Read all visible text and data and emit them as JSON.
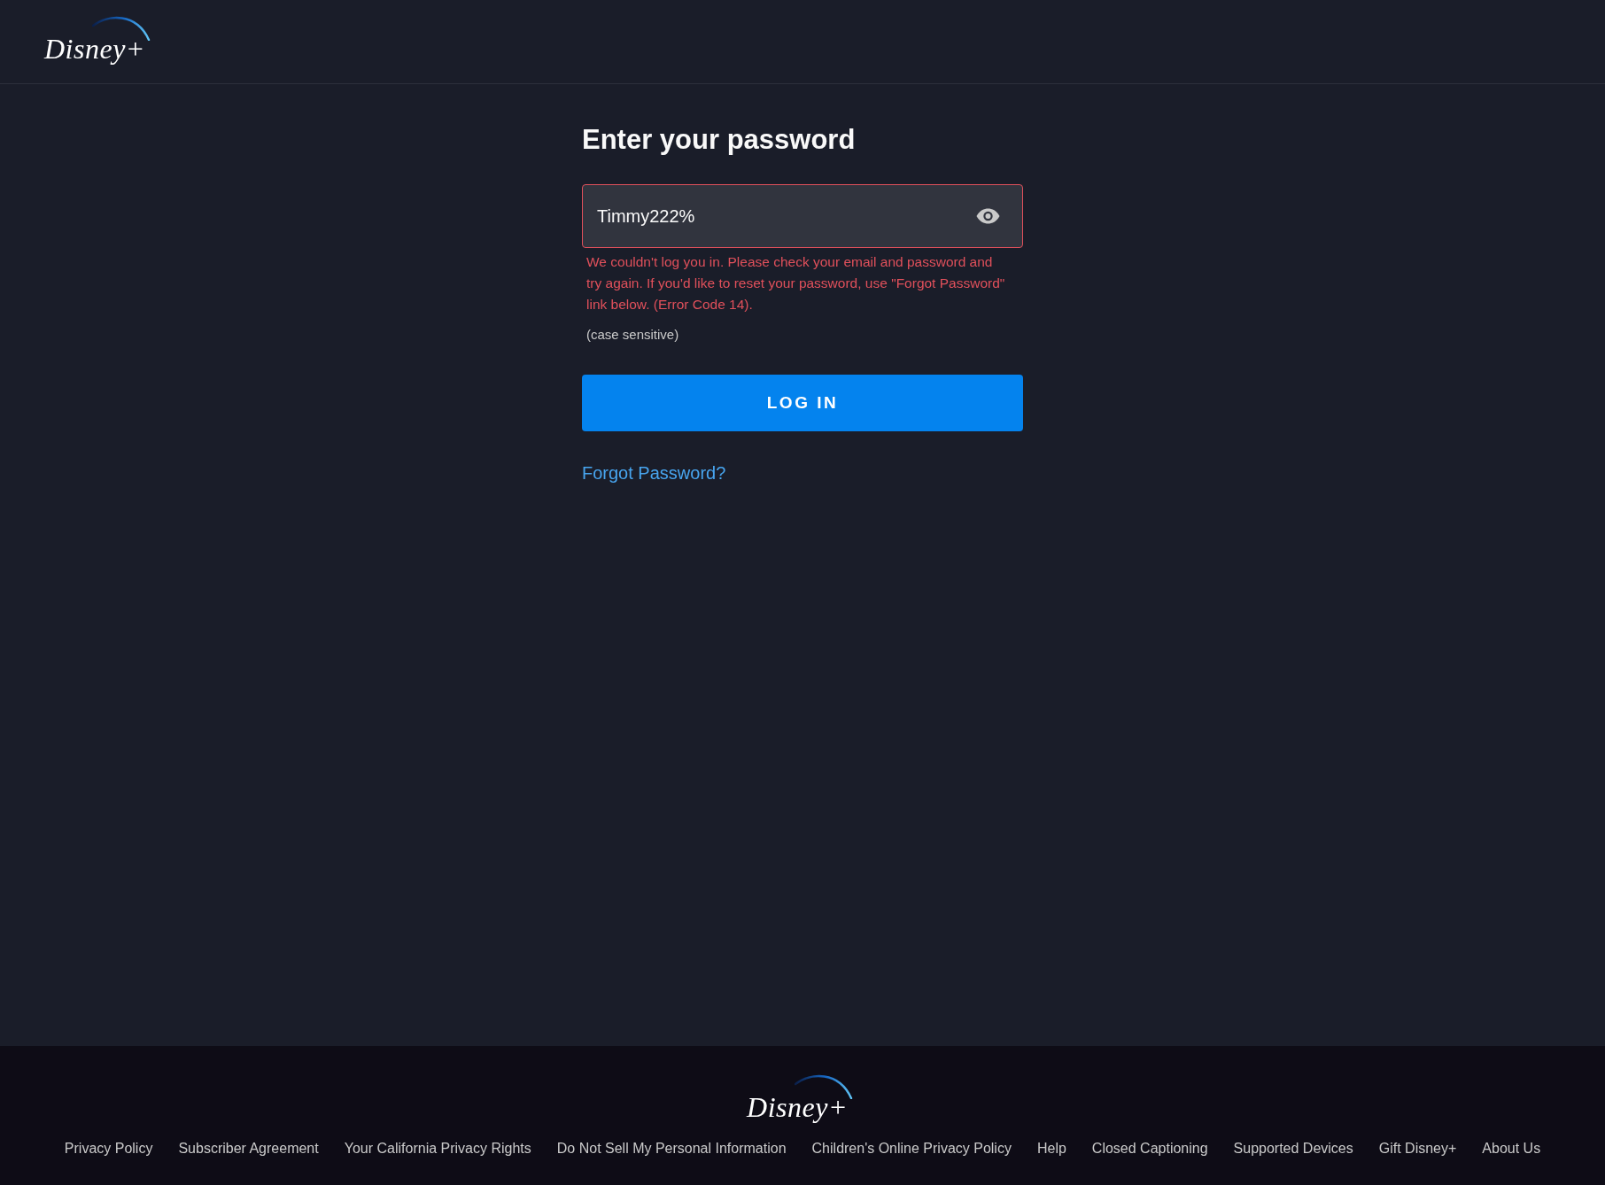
{
  "header": {
    "logo": "Disney+"
  },
  "form": {
    "title": "Enter your password",
    "password_field": {
      "value": "Timmy222%",
      "revealed": true,
      "error": true
    },
    "error_message": "We couldn't log you in. Please check your email and password and try again. If you'd like to reset your password, use \"Forgot Password\" link below. (Error Code 14).",
    "hint": "(case sensitive)",
    "submit_button": "LOG IN",
    "forgot_link": "Forgot Password?"
  },
  "footer": {
    "logo": "Disney+",
    "links": [
      "Privacy Policy",
      "Subscriber Agreement",
      "Your California Privacy Rights",
      "Do Not Sell My Personal Information",
      "Children's Online Privacy Policy",
      "Help",
      "Closed Captioning",
      "Supported Devices",
      "Gift Disney+",
      "About Us"
    ]
  }
}
